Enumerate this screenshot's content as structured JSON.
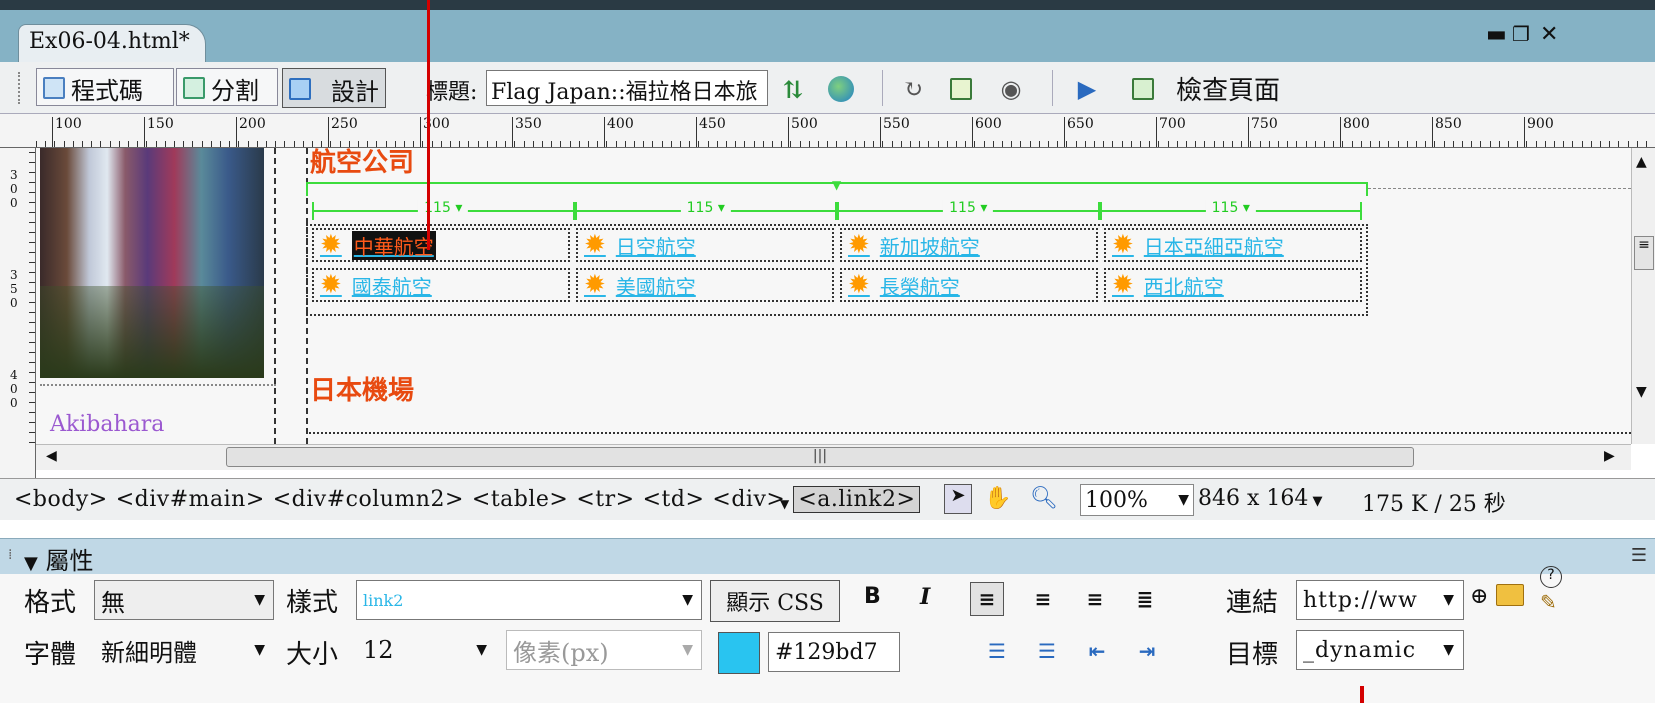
{
  "document": {
    "tab_title": "Ex06-04.html*"
  },
  "window_controls": {
    "minimize": "▬",
    "restore": "❐",
    "close": "✕"
  },
  "toolbar": {
    "code_label": "程式碼",
    "split_label": "分割",
    "design_label": "設計",
    "title_label": "標題:",
    "title_value": "Flag Japan::福拉格日本旅",
    "check_page_label": "檢查頁面"
  },
  "ruler": {
    "labels": [
      "100",
      "150",
      "200",
      "250",
      "300",
      "350",
      "400",
      "450",
      "500",
      "550",
      "600",
      "650",
      "700",
      "750",
      "800",
      "850",
      "900"
    ]
  },
  "vruler": {
    "labels": [
      "300",
      "350",
      "400"
    ]
  },
  "content": {
    "heading_airlines": "航空公司",
    "heading_airports": "日本機場",
    "photo_caption": "Akibahara",
    "col_width_label": "115",
    "airlines_row1": [
      "中華航空",
      "日空航空",
      "新加坡航空",
      "日本亞細亞航空"
    ],
    "airlines_row2": [
      "國泰航空",
      "美國航空",
      "長榮航空",
      "西北航空"
    ]
  },
  "tag_selector": {
    "tags": [
      "<body>",
      "<div#main>",
      "<div#column2>",
      "<table>",
      "<tr>",
      "<td>",
      "<div>"
    ],
    "selected_tag": "<a.link2>",
    "zoom": "100%",
    "dimensions": "846 x 164",
    "download": "175 K / 25 秒"
  },
  "properties": {
    "panel_title": "屬性",
    "format_label": "格式",
    "format_value": "無",
    "style_label": "樣式",
    "style_value": "link2",
    "show_css_label": "顯示 CSS",
    "bold_label": "B",
    "italic_label": "I",
    "link_label": "連結",
    "link_value": "http://ww",
    "font_label": "字體",
    "font_value": "新細明體",
    "size_label": "大小",
    "size_value": "12",
    "unit_value": "像素(px)",
    "color_value": "#129bd7",
    "target_label": "目標",
    "target_value": "_dynamic"
  },
  "colors": {
    "link": "#29b6e7",
    "heading": "#e84a10",
    "swatch": "#29c4f0",
    "accent": "#d40000",
    "ruler_green": "#3cdc3c"
  }
}
